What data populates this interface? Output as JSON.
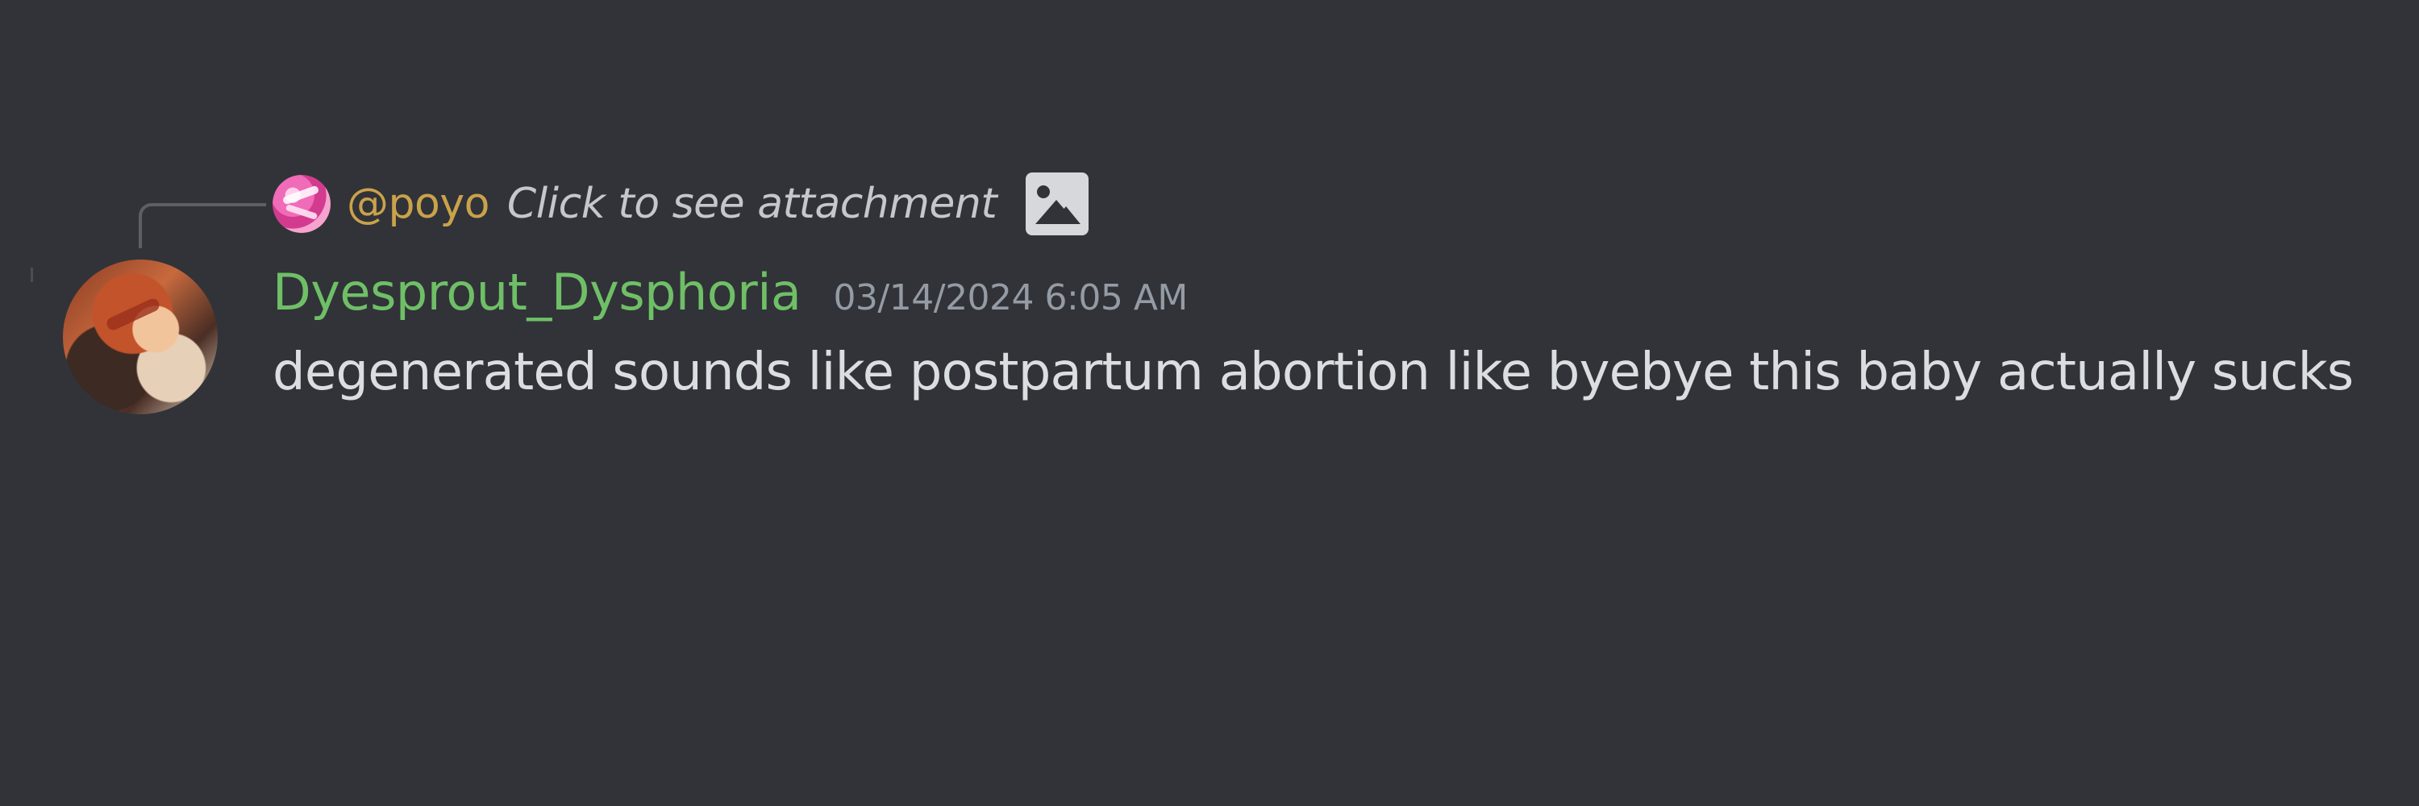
{
  "reply": {
    "mention": "@poyo",
    "preview": "Click to see attachment",
    "attachment_icon": "image-icon"
  },
  "message": {
    "username": "Dyesprout_Dysphoria",
    "timestamp": "03/14/2024 6:05 AM",
    "content": "degenerated sounds like postpartum abortion like byebye this baby actually sucks"
  },
  "colors": {
    "background": "#313338",
    "username": "#6fbf67",
    "mention": "#c9a24a",
    "timestamp": "#949ba4",
    "text": "#dbdee1"
  }
}
